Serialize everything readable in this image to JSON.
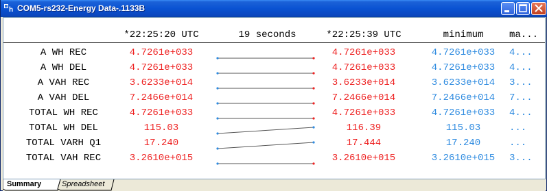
{
  "window": {
    "title": "COM5-rs232-Energy Data-.1133B",
    "app_icon": "meter-app-icon",
    "colors": {
      "title_bar": "#0a52d2",
      "value_red": "#ee2222",
      "value_blue": "#2e8be0"
    }
  },
  "columns": {
    "time1": "*22:25:20 UTC",
    "interval": "19 seconds",
    "time2": "*22:25:39 UTC",
    "minimum": "minimum",
    "maximum": "ma..."
  },
  "rows": [
    {
      "label": "A WH REC",
      "v1": "4.7261e+033",
      "v2": "4.7261e+033",
      "min": "4.7261e+033",
      "max": "4...",
      "trend": [
        0,
        0
      ]
    },
    {
      "label": "A WH DEL",
      "v1": "4.7261e+033",
      "v2": "4.7261e+033",
      "min": "4.7261e+033",
      "max": "4...",
      "trend": [
        0,
        0
      ]
    },
    {
      "label": "A VAH REC",
      "v1": "3.6233e+014",
      "v2": "3.6233e+014",
      "min": "3.6233e+014",
      "max": "3...",
      "trend": [
        0,
        0
      ]
    },
    {
      "label": "A VAH DEL",
      "v1": "7.2466e+014",
      "v2": "7.2466e+014",
      "min": "7.2466e+014",
      "max": "7...",
      "trend": [
        0,
        0
      ]
    },
    {
      "label": "TOTAL WH REC",
      "v1": "4.7261e+033",
      "v2": "4.7261e+033",
      "min": "4.7261e+033",
      "max": "4...",
      "trend": [
        0,
        0
      ]
    },
    {
      "label": "TOTAL WH DEL",
      "v1": "115.03",
      "v2": "116.39",
      "min": "115.03",
      "max": "...",
      "trend": [
        0,
        1
      ]
    },
    {
      "label": "TOTAL VARH Q1",
      "v1": "17.240",
      "v2": "17.444",
      "min": "17.240",
      "max": "...",
      "trend": [
        0,
        1
      ]
    },
    {
      "label": "TOTAL VAH REC",
      "v1": "3.2610e+015",
      "v2": "3.2610e+015",
      "min": "3.2610e+015",
      "max": "3...",
      "trend": [
        0,
        0
      ]
    }
  ],
  "tabs": [
    {
      "label": "Summary",
      "active": true
    },
    {
      "label": "Spreadsheet",
      "active": false
    }
  ]
}
